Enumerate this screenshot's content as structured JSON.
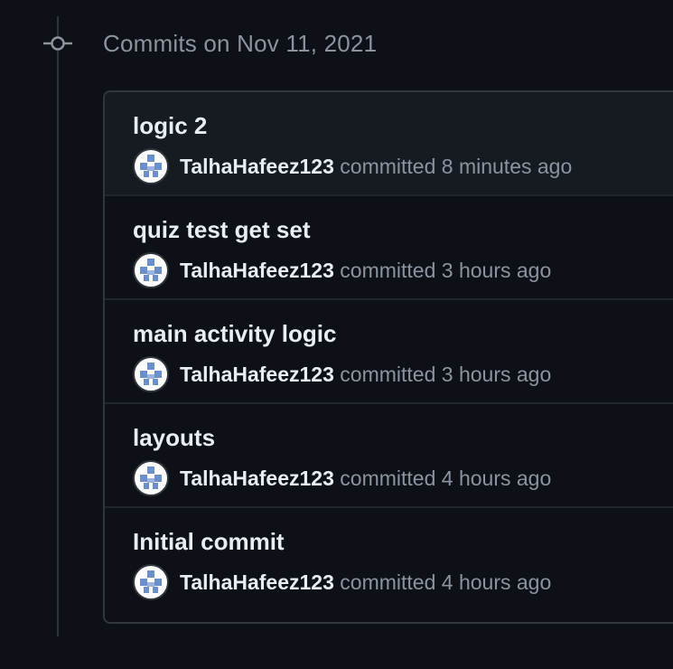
{
  "group": {
    "header": "Commits on Nov 11, 2021"
  },
  "commits": [
    {
      "title": "logic 2",
      "author": "TalhaHafeez123",
      "action": "committed",
      "time": "8 minutes ago"
    },
    {
      "title": "quiz test get set",
      "author": "TalhaHafeez123",
      "action": "committed",
      "time": "3 hours ago"
    },
    {
      "title": "main activity logic",
      "author": "TalhaHafeez123",
      "action": "committed",
      "time": "3 hours ago"
    },
    {
      "title": "layouts",
      "author": "TalhaHafeez123",
      "action": "committed",
      "time": "4 hours ago"
    },
    {
      "title": "Initial commit",
      "author": "TalhaHafeez123",
      "action": "committed",
      "time": "4 hours ago"
    }
  ],
  "colors": {
    "background": "#0d1117",
    "border": "#30363d",
    "text_primary": "#e6edf3",
    "text_muted": "#8b949e",
    "avatar_identicon": "#6a8fd1",
    "row_highlight": "#161b22"
  },
  "icons": {
    "timeline_node": "git-commit-icon",
    "avatar": "identicon-avatar"
  }
}
